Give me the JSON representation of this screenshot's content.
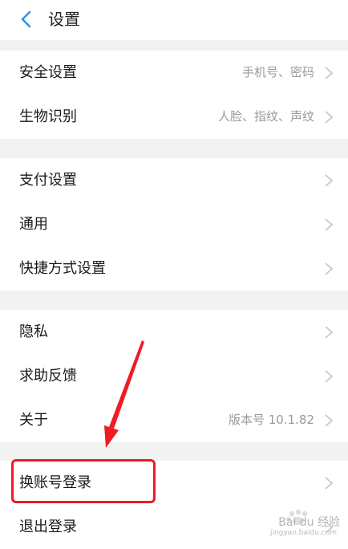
{
  "header": {
    "title": "设置"
  },
  "groups": [
    {
      "items": [
        {
          "label": "安全设置",
          "value": "手机号、密码"
        },
        {
          "label": "生物识别",
          "value": "人脸、指纹、声纹"
        }
      ]
    },
    {
      "items": [
        {
          "label": "支付设置",
          "value": ""
        },
        {
          "label": "通用",
          "value": ""
        },
        {
          "label": "快捷方式设置",
          "value": ""
        }
      ]
    },
    {
      "items": [
        {
          "label": "隐私",
          "value": ""
        },
        {
          "label": "求助反馈",
          "value": ""
        },
        {
          "label": "关于",
          "value": "版本号 10.1.82"
        }
      ]
    },
    {
      "items": [
        {
          "label": "换账号登录",
          "value": ""
        },
        {
          "label": "退出登录",
          "value": ""
        }
      ]
    }
  ],
  "annotation": {
    "highlight_color": "#ee1c25"
  },
  "watermark": {
    "brand": "Bai du 经验",
    "url": "jingyan.baidu.com"
  },
  "colors": {
    "background": "#f2f2f2",
    "accent": "#3a8ee6"
  }
}
